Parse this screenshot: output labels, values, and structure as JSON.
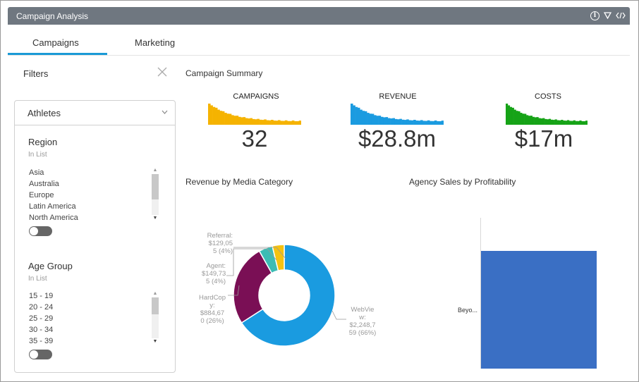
{
  "window": {
    "title": "Campaign Analysis",
    "icons": [
      "info-icon",
      "filter-icon",
      "code-icon"
    ]
  },
  "tabs": [
    {
      "label": "Campaigns",
      "active": true
    },
    {
      "label": "Marketing",
      "active": false
    }
  ],
  "filters": {
    "title": "Filters",
    "panel_title": "Athletes",
    "region": {
      "title": "Region",
      "mode": "In List",
      "items": [
        "Asia",
        "Australia",
        "Europe",
        "Latin America",
        "North America"
      ]
    },
    "age_group": {
      "title": "Age Group",
      "mode": "In List",
      "items": [
        "15 - 19",
        "20 - 24",
        "25 - 29",
        "30 - 34",
        "35 - 39"
      ]
    }
  },
  "summary": {
    "title": "Campaign Summary",
    "kpis": [
      {
        "label": "CAMPAIGNS",
        "value": "32",
        "color": "#f5b301"
      },
      {
        "label": "REVENUE",
        "value": "$28.8m",
        "color": "#1b9be0"
      },
      {
        "label": "COSTS",
        "value": "$17m",
        "color": "#16a317"
      }
    ]
  },
  "revenue_chart": {
    "title": "Revenue by Media Category",
    "labels": {
      "referral": [
        "Referral:",
        "$129,05",
        "5 (4%)"
      ],
      "agent": [
        "Agent:",
        "$149,73",
        "5 (4%)"
      ],
      "hardcopy": [
        "HardCop",
        "y:",
        "$884,67",
        "0 (26%)"
      ],
      "webview": [
        "WebVie",
        "w:",
        "$2,248,7",
        "59 (66%)"
      ]
    }
  },
  "agency_chart": {
    "title": "Agency Sales by Profitability",
    "category": "Beyo..."
  },
  "chart_data": [
    {
      "type": "pie",
      "title": "Revenue by Media Category",
      "categories": [
        "WebView",
        "HardCopy",
        "Agent",
        "Referral"
      ],
      "values": [
        2248759,
        884670,
        149735,
        129055
      ],
      "colors": [
        "#1a9be0",
        "#7a0f55",
        "#3cbcb4",
        "#f5c210"
      ]
    },
    {
      "type": "bar",
      "title": "Agency Sales by Profitability",
      "categories": [
        "Beyo..."
      ],
      "values": [
        1
      ],
      "colors": [
        "#3a6fc4"
      ]
    }
  ]
}
